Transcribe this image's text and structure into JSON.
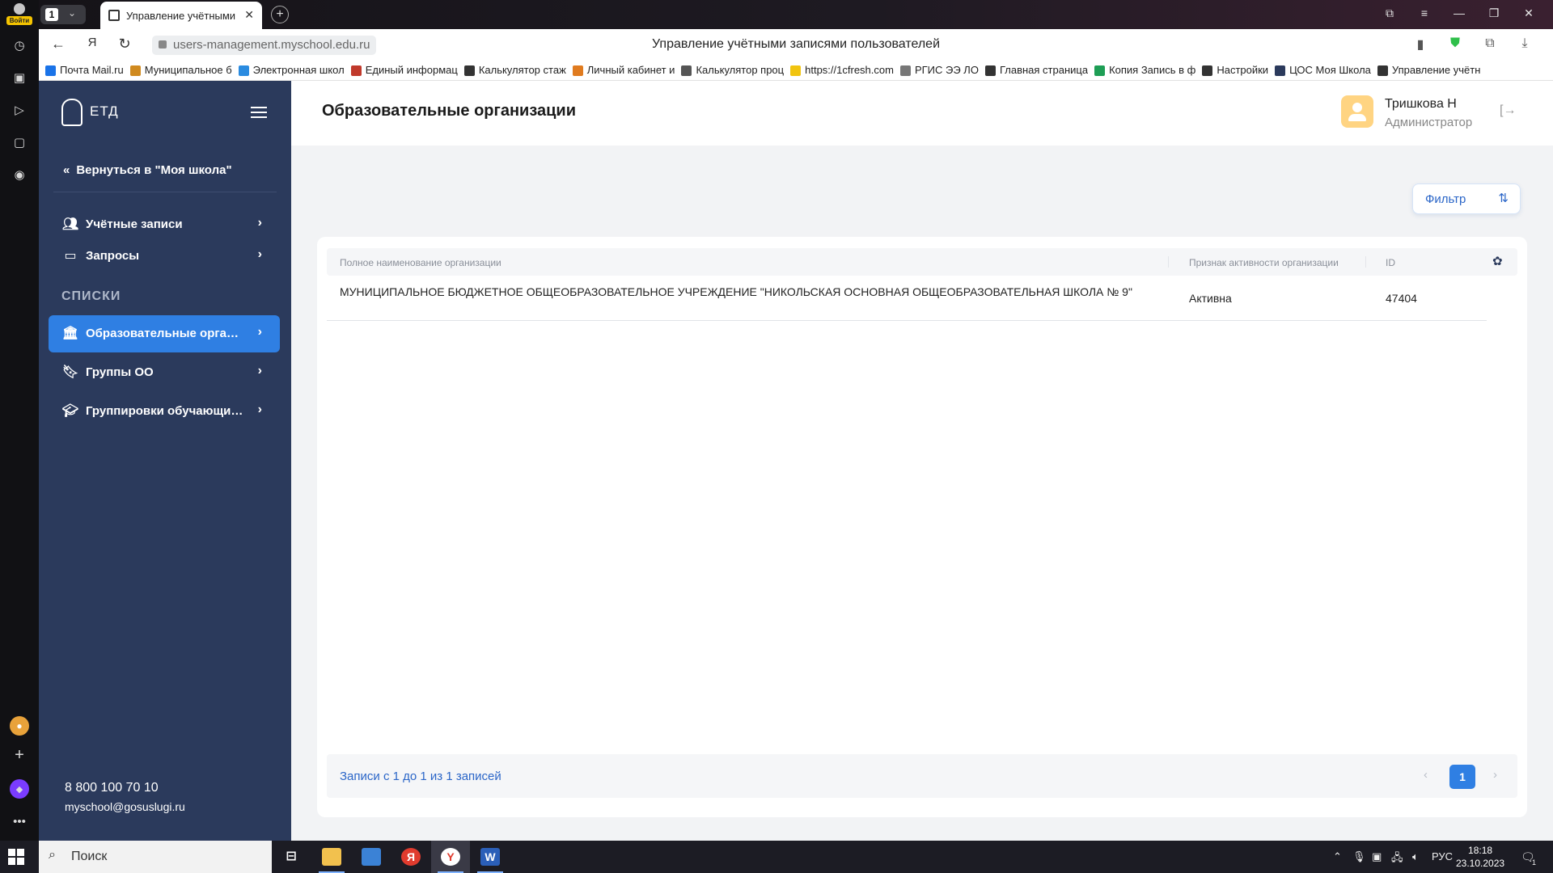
{
  "browser": {
    "login_badge": "Войти",
    "tab_count": "1",
    "tab_title": "Управление учётными",
    "url": "users-management.myschool.edu.ru",
    "page_title": "Управление учётными записями пользователей",
    "bookmarks": [
      {
        "label": "Почта Mail.ru",
        "color": "#1a73e8"
      },
      {
        "label": "Муниципальное б",
        "color": "#d08a1f"
      },
      {
        "label": "Электронная школ",
        "color": "#2a8be0"
      },
      {
        "label": "Единый информац",
        "color": "#c0392b"
      },
      {
        "label": "Калькулятор стаж",
        "color": "#333333"
      },
      {
        "label": "Личный кабинет и",
        "color": "#e07b1f"
      },
      {
        "label": "Калькулятор проц",
        "color": "#555555"
      },
      {
        "label": "https://1cfresh.com",
        "color": "#f1c40f"
      },
      {
        "label": "РГИС ЭЭ ЛО",
        "color": "#777777"
      },
      {
        "label": "Главная страница",
        "color": "#333333"
      },
      {
        "label": "Копия Запись в ф",
        "color": "#1e9e55"
      },
      {
        "label": "Настройки",
        "color": "#333333"
      },
      {
        "label": "ЦОС Моя Школа",
        "color": "#2b3a5c"
      },
      {
        "label": "Управление учётн",
        "color": "#333333"
      }
    ]
  },
  "sidebar": {
    "logo": "ЕТД",
    "back_link": "Вернуться в \"Моя школа\"",
    "items": [
      {
        "label": "Учётные записи",
        "icon": "users-icon"
      },
      {
        "label": "Запросы",
        "icon": "inbox-icon"
      }
    ],
    "section_heading": "СПИСКИ",
    "list_items": [
      {
        "label": "Образовательные организации",
        "icon": "institution-icon",
        "active": true
      },
      {
        "label": "Группы ОО",
        "icon": "bookmark-icon",
        "active": false
      },
      {
        "label": "Группировки обучающихся",
        "icon": "graduation-cap-icon",
        "active": false
      }
    ],
    "phone": "8 800 100 70 10",
    "email": "myschool@gosuslugi.ru"
  },
  "header": {
    "title": "Образовательные организации",
    "user_name": "Тришкова Н",
    "user_role": "Администратор"
  },
  "filter": {
    "label": "Фильтр"
  },
  "table": {
    "columns": [
      "Полное наименование организации",
      "Признак активности организации",
      "ID"
    ],
    "rows": [
      {
        "name": "МУНИЦИПАЛЬНОЕ БЮДЖЕТНОЕ ОБЩЕОБРАЗОВАТЕЛЬНОЕ УЧРЕЖДЕНИЕ \"НИКОЛЬСКАЯ ОСНОВНАЯ ОБЩЕОБРАЗОВАТЕЛЬНАЯ ШКОЛА № 9\"",
        "status": "Активна",
        "id": "47404"
      }
    ]
  },
  "pagination": {
    "info": "Записи с 1 до 1 из 1 записей",
    "current_page": "1"
  },
  "taskbar": {
    "search_placeholder": "Поиск",
    "language": "РУС",
    "time": "18:18",
    "date": "23.10.2023",
    "notification_count": "1"
  },
  "colors": {
    "sidebar_bg": "#2b3a5c",
    "accent": "#2f7fe3",
    "link": "#2b66c8"
  }
}
